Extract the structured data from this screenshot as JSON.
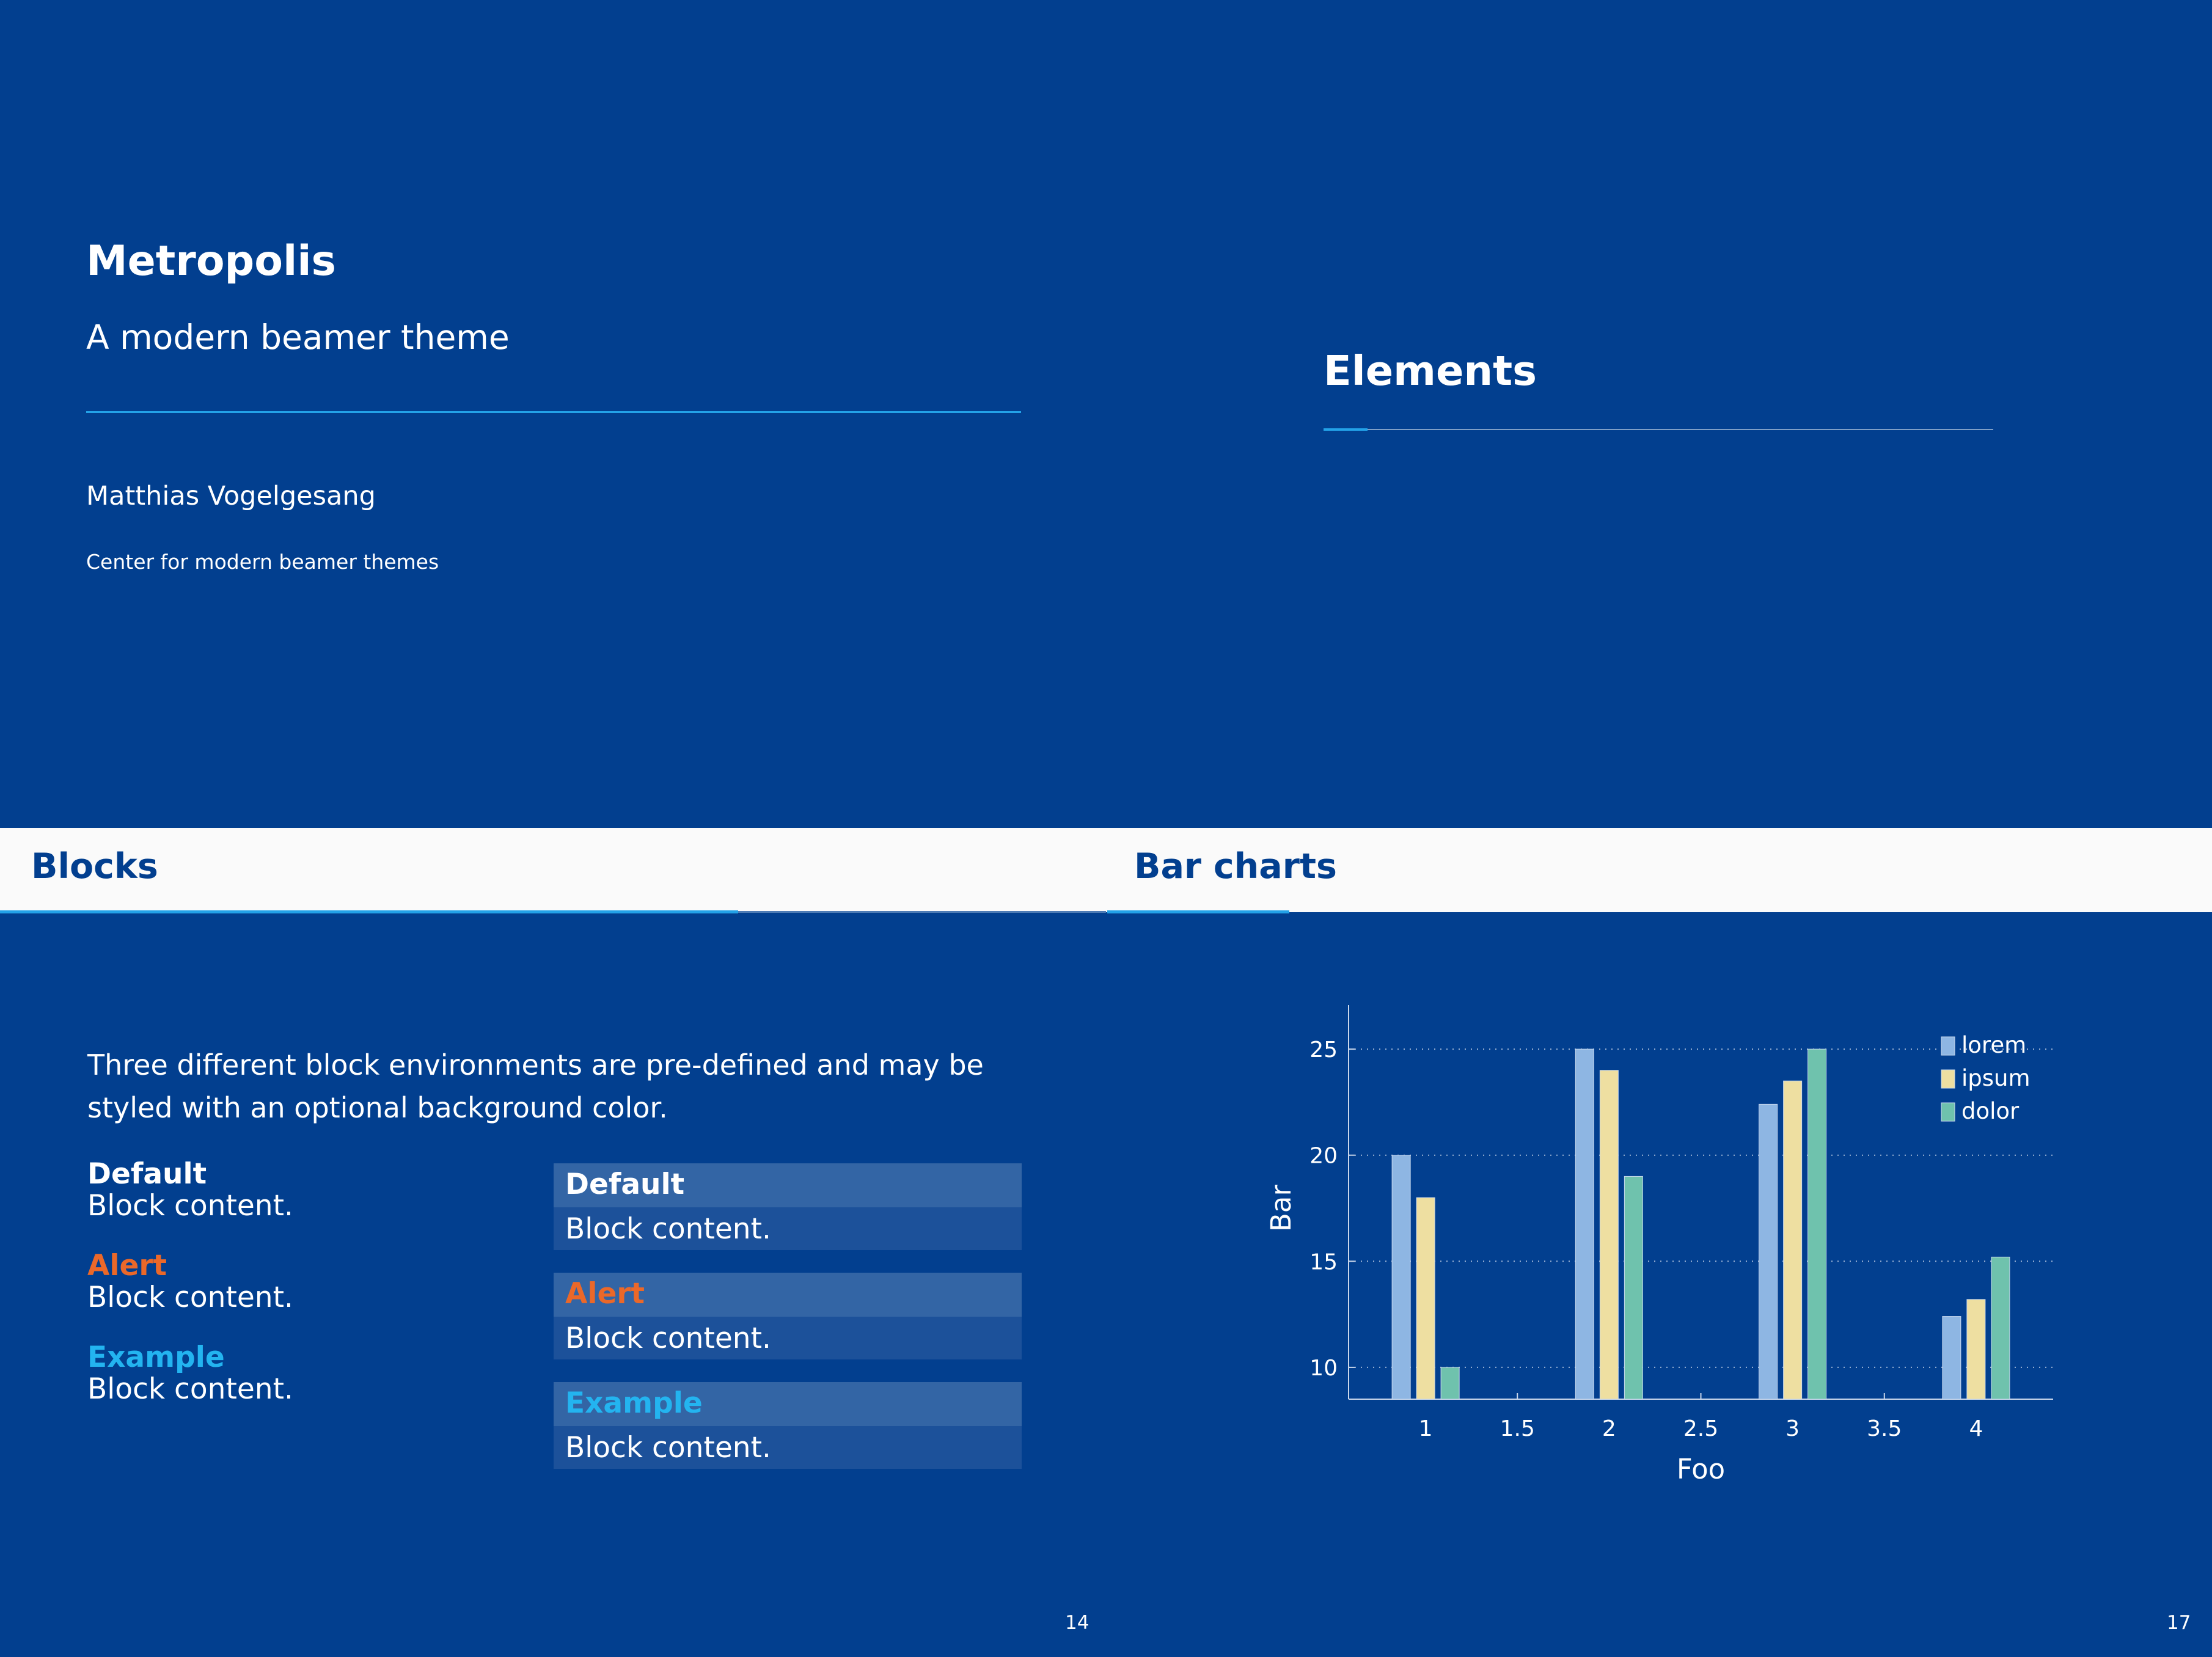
{
  "title_slide": {
    "title": "Metropolis",
    "subtitle": "A modern beamer theme",
    "author": "Matthias Vogelgesang",
    "institute": "Center for modern beamer themes"
  },
  "section_slide": {
    "title": "Elements"
  },
  "blocks_slide": {
    "frame_title": "Blocks",
    "paragraph": "Three different block environments are pre-defined and may be styled with an optional background color.",
    "plain_blocks": [
      {
        "title": "Default",
        "body": "Block content."
      },
      {
        "title": "Alert",
        "body": "Block content."
      },
      {
        "title": "Example",
        "body": "Block content."
      }
    ],
    "filled_blocks": [
      {
        "title": "Default",
        "body": "Block content."
      },
      {
        "title": "Alert",
        "body": "Block content."
      },
      {
        "title": "Example",
        "body": "Block content."
      }
    ],
    "page_number": "14"
  },
  "barchart_slide": {
    "frame_title": "Bar charts",
    "page_number": "17"
  },
  "colors": {
    "background": "#023f8f",
    "frame_bar": "#fafafa",
    "progress": "#23a2e8",
    "alert": "#eb6829",
    "example": "#23b4f0"
  },
  "chart_data": {
    "type": "bar",
    "x": [
      1,
      2,
      3,
      4
    ],
    "series": [
      {
        "name": "lorem",
        "values": [
          20,
          25,
          22.4,
          12.4
        ],
        "color": "#8eb6e3"
      },
      {
        "name": "ipsum",
        "values": [
          18,
          24,
          23.5,
          13.2
        ],
        "color": "#eedfa1"
      },
      {
        "name": "dolor",
        "values": [
          10,
          19,
          25,
          15.2
        ],
        "color": "#6fc2ad"
      }
    ],
    "xticks": [
      "1",
      "1.5",
      "2",
      "2.5",
      "3",
      "3.5",
      "4"
    ],
    "yticks": [
      "10",
      "15",
      "20",
      "25"
    ],
    "xlabel": "Foo",
    "ylabel": "Bar",
    "xlim": [
      0.58,
      4.42
    ],
    "ylim": [
      8.5,
      26.5
    ],
    "grid": "horizontal dotted",
    "legend": "top-right"
  }
}
